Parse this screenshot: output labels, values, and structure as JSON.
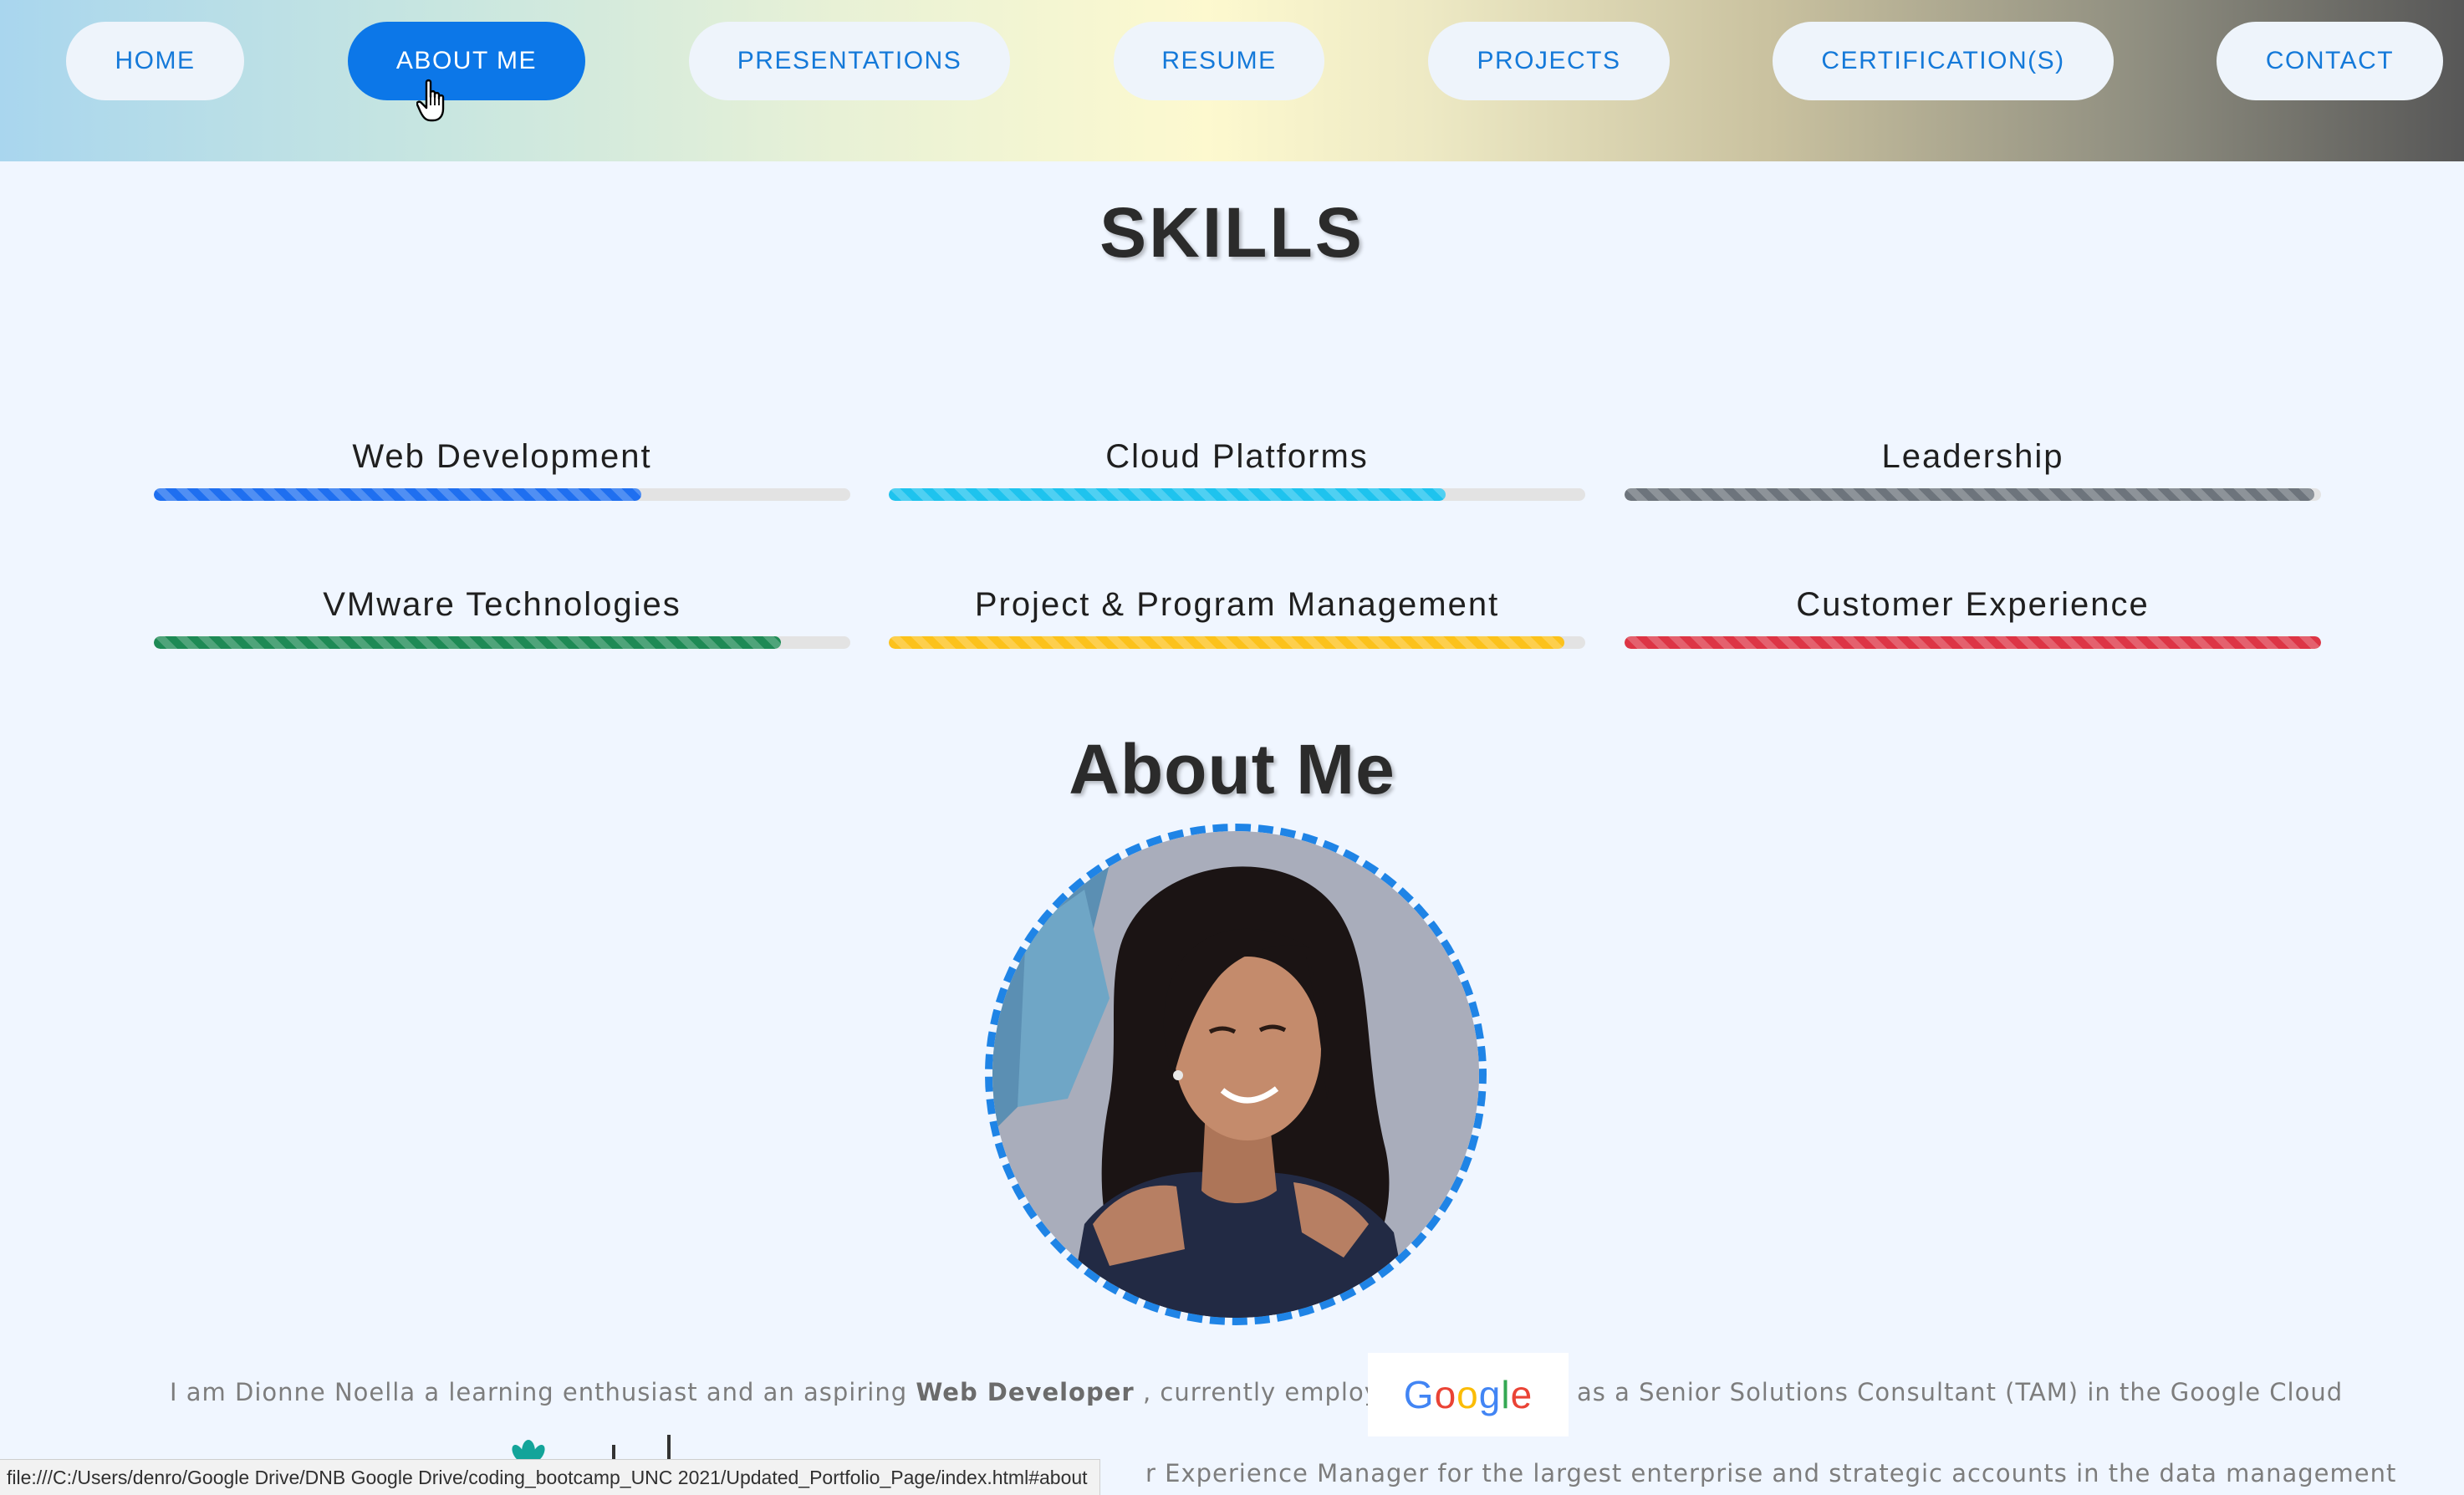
{
  "nav": {
    "items": [
      {
        "label": "HOME",
        "active": false
      },
      {
        "label": "ABOUT ME",
        "active": true
      },
      {
        "label": "PRESENTATIONS",
        "active": false
      },
      {
        "label": "RESUME",
        "active": false
      },
      {
        "label": "PROJECTS",
        "active": false
      },
      {
        "label": "CERTIFICATION(S)",
        "active": false
      },
      {
        "label": "CONTACT",
        "active": false
      }
    ]
  },
  "skills": {
    "title": "SKILLS",
    "items": [
      {
        "label": "Web Development",
        "level_percent": 70,
        "color": "#1f6ff0"
      },
      {
        "label": "Cloud Platforms",
        "level_percent": 80,
        "color": "#1ec3ee"
      },
      {
        "label": "Leadership",
        "level_percent": 99,
        "color": "#6d747c"
      },
      {
        "label": "VMware Technologies",
        "level_percent": 90,
        "color": "#1e8a55"
      },
      {
        "label": "Project & Program Management",
        "level_percent": 97,
        "color": "#fcc21b"
      },
      {
        "label": "Customer Experience",
        "level_percent": 100,
        "color": "#dd3545"
      }
    ]
  },
  "about": {
    "title": "About Me",
    "intro_prefix": "I am Dionne Noella a learning enthusiast and an aspiring",
    "role": "Web Developer",
    "intro_middle": ", currently employed at",
    "employer_logo_text": "Google",
    "intro_suffix": "as a Senior Solutions Consultant (TAM) in the Google Cloud",
    "line2_visible": "r Experience Manager for the largest enterprise and strategic accounts in the data management"
  },
  "status_bar": {
    "url": "file:///C:/Users/denro/Google Drive/DNB Google Drive/coding_bootcamp_UNC 2021/Updated_Portfolio_Page/index.html#about"
  },
  "colors": {
    "nav_text": "#1479d9",
    "nav_active_bg": "#0c77e8",
    "page_bg": "#f0f6ff",
    "avatar_border": "#1f84e6"
  }
}
